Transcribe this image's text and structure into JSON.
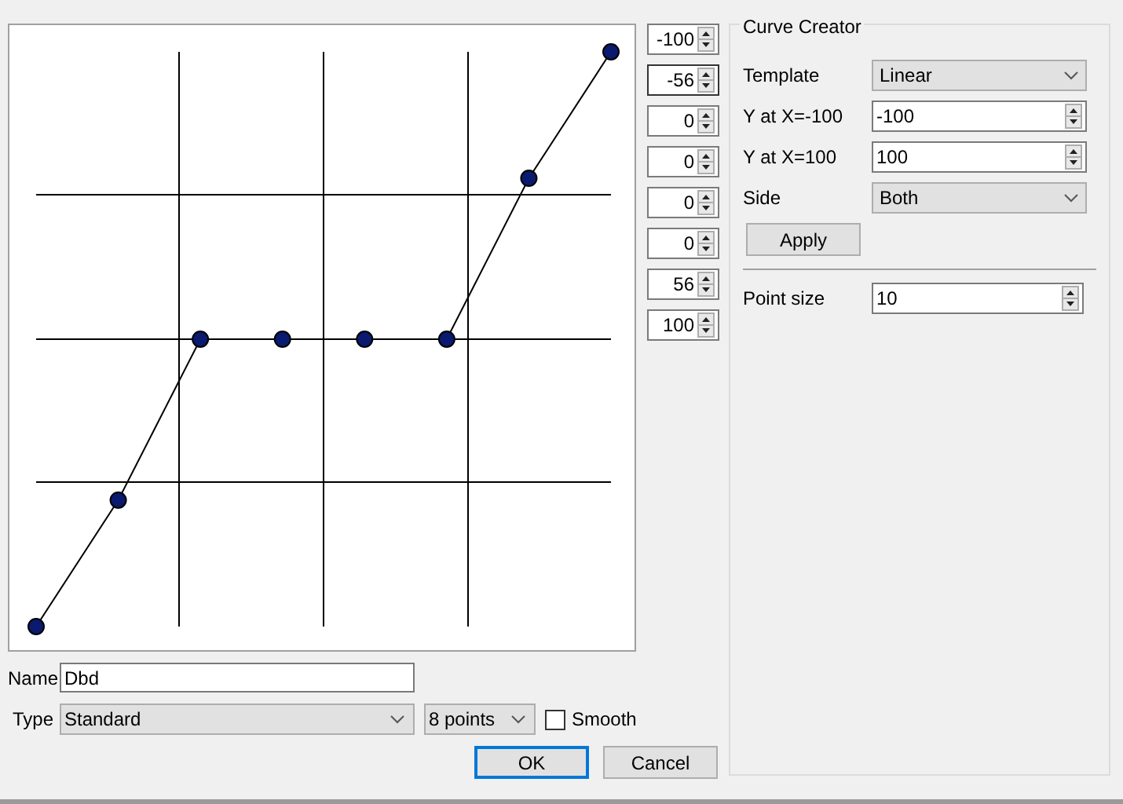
{
  "points": [
    {
      "value": "-100",
      "focused": false
    },
    {
      "value": "-56",
      "focused": true
    },
    {
      "value": "0",
      "focused": false
    },
    {
      "value": "0",
      "focused": false
    },
    {
      "value": "0",
      "focused": false
    },
    {
      "value": "0",
      "focused": false
    },
    {
      "value": "56",
      "focused": false
    },
    {
      "value": "100",
      "focused": false
    }
  ],
  "name": {
    "label": "Name",
    "value": "Dbd"
  },
  "type": {
    "label": "Type",
    "value": "Standard"
  },
  "point_count": {
    "value": "8 points"
  },
  "smooth": {
    "label": "Smooth",
    "checked": false
  },
  "buttons": [
    {
      "label": "OK",
      "default": true
    },
    {
      "label": "Cancel",
      "default": false
    }
  ],
  "curve_creator": {
    "title": "Curve Creator",
    "fields": [
      {
        "kind": "combo",
        "label": "Template",
        "value": "Linear"
      },
      {
        "kind": "spin",
        "label": "Y at X=-100",
        "value": "-100"
      },
      {
        "kind": "spin",
        "label": "Y at X=100",
        "value": "100"
      },
      {
        "kind": "combo",
        "label": "Side",
        "value": "Both"
      }
    ],
    "apply": "Apply",
    "point_size": {
      "label": "Point size",
      "value": "10"
    }
  }
}
